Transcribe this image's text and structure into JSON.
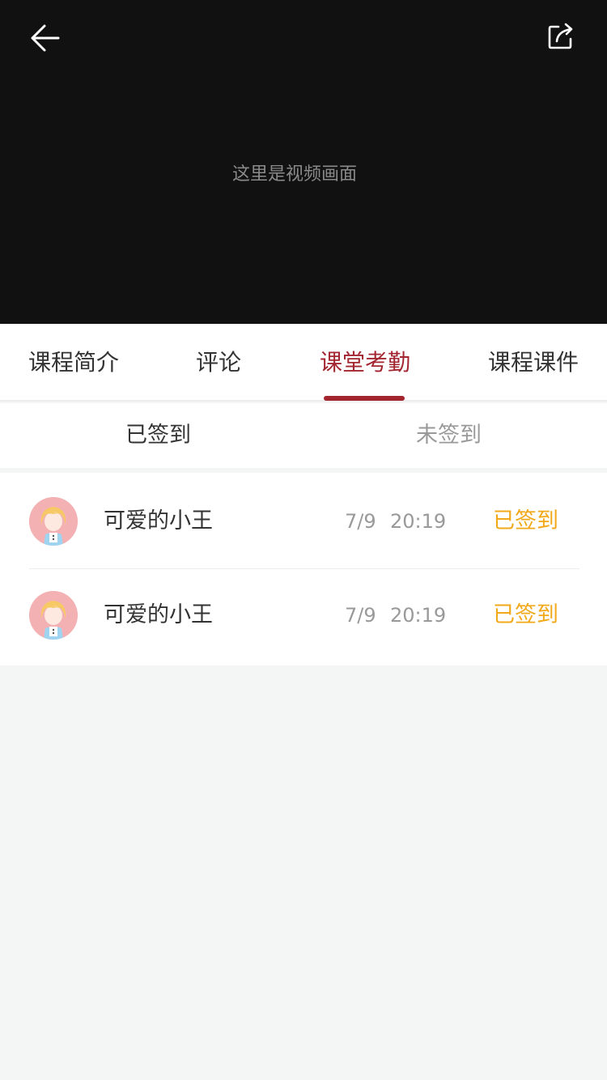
{
  "video": {
    "placeholder_text": "这里是视频画面",
    "back_icon": "arrow-left-icon",
    "share_icon": "share-icon"
  },
  "tabs": [
    {
      "label": "课程简介",
      "active": false
    },
    {
      "label": "评论",
      "active": false
    },
    {
      "label": "课堂考勤",
      "active": true
    },
    {
      "label": "课程课件",
      "active": false
    }
  ],
  "subtabs": {
    "signed_label": "已签到",
    "unsigned_label": "未签到",
    "selected": "已签到"
  },
  "attendance": [
    {
      "name": "可爱的小王",
      "date": "7/9",
      "time": "20:19",
      "status": "已签到"
    },
    {
      "name": "可爱的小王",
      "date": "7/9",
      "time": "20:19",
      "status": "已签到"
    }
  ],
  "colors": {
    "accent": "#a22530",
    "status_signed": "#f2a818",
    "video_bg": "#111111",
    "page_bg": "#f4f5f5"
  }
}
